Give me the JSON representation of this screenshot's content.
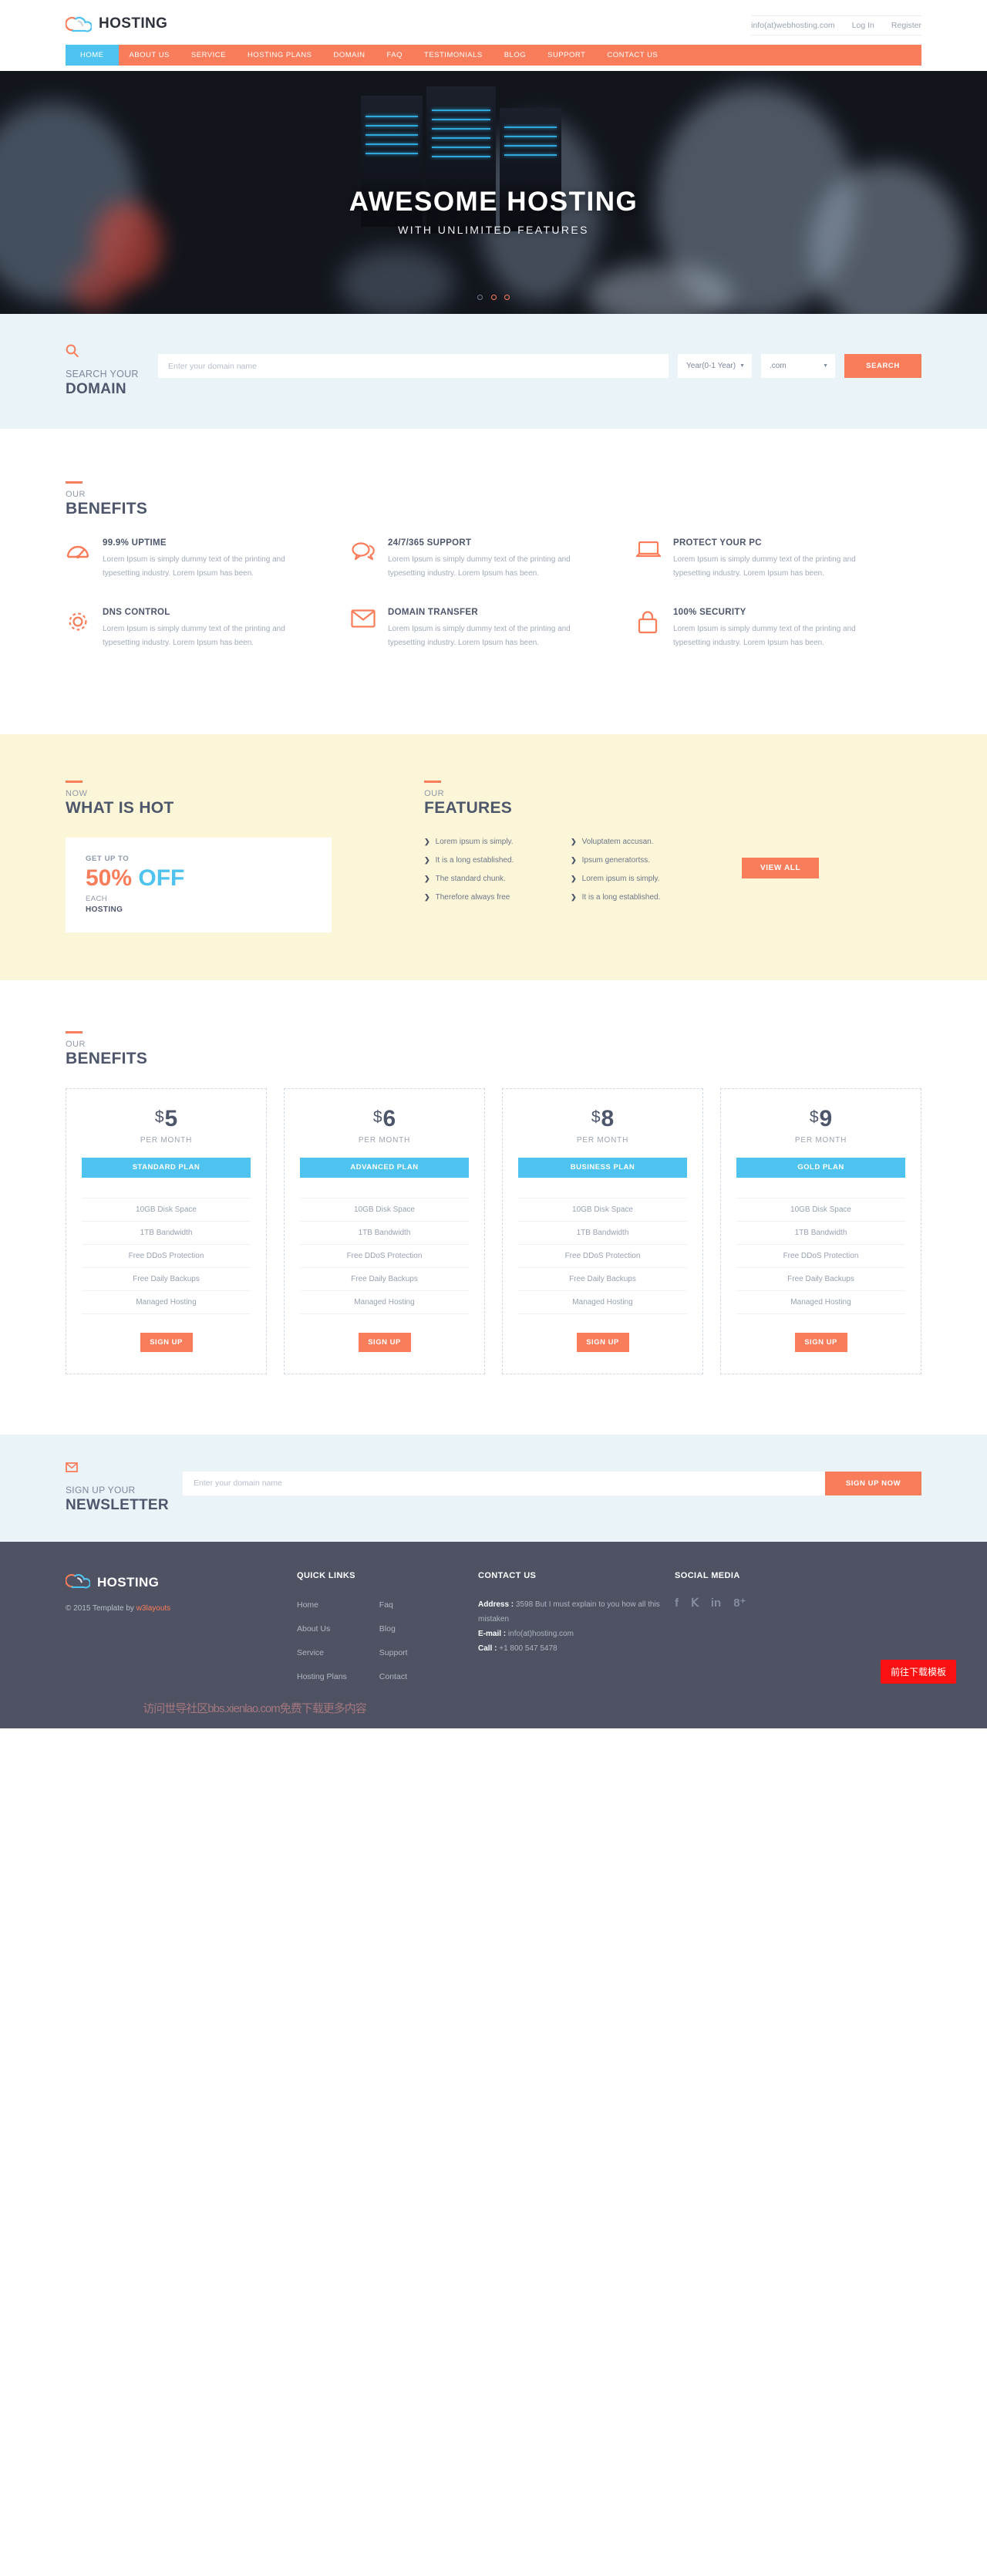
{
  "header": {
    "logo_text": "HOSTING",
    "email": "info(at)webhosting.com",
    "login": "Log In",
    "register": "Register"
  },
  "nav": {
    "items": [
      {
        "label": "HOME",
        "active": true
      },
      {
        "label": "ABOUT US",
        "active": false
      },
      {
        "label": "SERVICE",
        "active": false
      },
      {
        "label": "HOSTING PLANS",
        "active": false
      },
      {
        "label": "DOMAIN",
        "active": false
      },
      {
        "label": "FAQ",
        "active": false
      },
      {
        "label": "TESTIMONIALS",
        "active": false
      },
      {
        "label": "BLOG",
        "active": false
      },
      {
        "label": "SUPPORT",
        "active": false
      },
      {
        "label": "CONTACT US",
        "active": false
      }
    ]
  },
  "hero": {
    "title": "AWESOME HOSTING",
    "subtitle": "WITH UNLIMITED FEATURES",
    "slide_count": 3,
    "active_slide": 0
  },
  "domain_search": {
    "icon": "search-icon",
    "line1": "SEARCH YOUR",
    "line2": "DOMAIN",
    "input_placeholder": "Enter your domain name",
    "input_value": "",
    "year_selected": "Year(0-1 Year)",
    "tld_selected": ".com",
    "button": "SEARCH"
  },
  "benefits_top": {
    "eyebrow": "OUR",
    "title": "BENEFITS",
    "items": [
      {
        "icon": "speedometer-icon",
        "title": "99.9% UPTIME",
        "desc": "Lorem Ipsum is simply dummy text of the printing and typesetting industry. Lorem Ipsum has been."
      },
      {
        "icon": "chat-bubbles-icon",
        "title": "24/7/365 SUPPORT",
        "desc": "Lorem Ipsum is simply dummy text of the printing and typesetting industry. Lorem Ipsum has been."
      },
      {
        "icon": "laptop-icon",
        "title": "PROTECT YOUR PC",
        "desc": "Lorem Ipsum is simply dummy text of the printing and typesetting industry. Lorem Ipsum has been."
      },
      {
        "icon": "gear-icon",
        "title": "DNS CONTROL",
        "desc": "Lorem Ipsum is simply dummy text of the printing and typesetting industry. Lorem Ipsum has been."
      },
      {
        "icon": "envelope-icon",
        "title": "DOMAIN TRANSFER",
        "desc": "Lorem Ipsum is simply dummy text of the printing and typesetting industry. Lorem Ipsum has been."
      },
      {
        "icon": "lock-icon",
        "title": "100% SECURITY",
        "desc": "Lorem Ipsum is simply dummy text of the printing and typesetting industry. Lorem Ipsum has been."
      }
    ]
  },
  "hot": {
    "eyebrow": "NOW",
    "title": "WHAT IS HOT",
    "card": {
      "line1": "GET UP TO",
      "percent": "50%",
      "off": "OFF",
      "line3": "EACH",
      "line4": "HOSTING"
    }
  },
  "features": {
    "eyebrow": "OUR",
    "title": "FEATURES",
    "col1": [
      "Lorem ipsum is simply.",
      "It is a long established.",
      "The standard chunk.",
      "Therefore always free"
    ],
    "col2": [
      "Voluptatem accusan.",
      "Ipsum generatortss.",
      "Lorem ipsum is simply.",
      "It is a long established."
    ],
    "view_all": "VIEW ALL"
  },
  "pricing": {
    "eyebrow": "OUR",
    "title": "BENEFITS",
    "per_month": "PER MONTH",
    "currency": "$",
    "signup_label": "SIGN UP",
    "plans": [
      {
        "amount": "5",
        "plan_label": "STANDARD PLAN",
        "features": [
          "10GB Disk Space",
          "1TB Bandwidth",
          "Free DDoS Protection",
          "Free Daily Backups",
          "Managed Hosting"
        ]
      },
      {
        "amount": "6",
        "plan_label": "ADVANCED PLAN",
        "features": [
          "10GB Disk Space",
          "1TB Bandwidth",
          "Free DDoS Protection",
          "Free Daily Backups",
          "Managed Hosting"
        ]
      },
      {
        "amount": "8",
        "plan_label": "BUSINESS PLAN",
        "features": [
          "10GB Disk Space",
          "1TB Bandwidth",
          "Free DDoS Protection",
          "Free Daily Backups",
          "Managed Hosting"
        ]
      },
      {
        "amount": "9",
        "plan_label": "GOLD PLAN",
        "features": [
          "10GB Disk Space",
          "1TB Bandwidth",
          "Free DDoS Protection",
          "Free Daily Backups",
          "Managed Hosting"
        ]
      }
    ]
  },
  "newsletter": {
    "icon": "envelope-icon",
    "line1": "SIGN UP YOUR",
    "line2": "NEWSLETTER",
    "input_placeholder": "Enter your domain name",
    "input_value": "",
    "button": "SIGN UP NOW"
  },
  "footer": {
    "logo_text": "HOSTING",
    "copyright_prefix": "© 2015 Template by ",
    "copyright_link": "w3layouts",
    "quick_links_title": "QUICK LINKS",
    "quick_links_col1": [
      "Home",
      "About Us",
      "Service",
      "Hosting Plans"
    ],
    "quick_links_col2": [
      "Faq",
      "Blog",
      "Support",
      "Contact"
    ],
    "contact_title": "CONTACT US",
    "address_label": "Address : ",
    "address_value": "3598 But I must explain to you how all this mistaken",
    "email_label": "E-mail : ",
    "email_value": "info(at)hosting.com",
    "call_label": "Call : ",
    "call_value": "+1 800 547 5478",
    "social_title": "SOCIAL MEDIA",
    "socials": [
      "facebook-icon",
      "twitter-icon",
      "linkedin-icon",
      "googleplus-icon"
    ],
    "download_badge": "前往下载模板",
    "watermark": "访问世导社区bbs.xienlao.com免费下载更多内容"
  },
  "colors": {
    "accent_orange": "#fa7d5b",
    "accent_blue": "#4fc3f0",
    "dark_text": "#4d566b",
    "footer_bg": "#4e5263",
    "light_blue_bg": "#e9f3f8",
    "cream_bg": "#fcf6d8"
  }
}
